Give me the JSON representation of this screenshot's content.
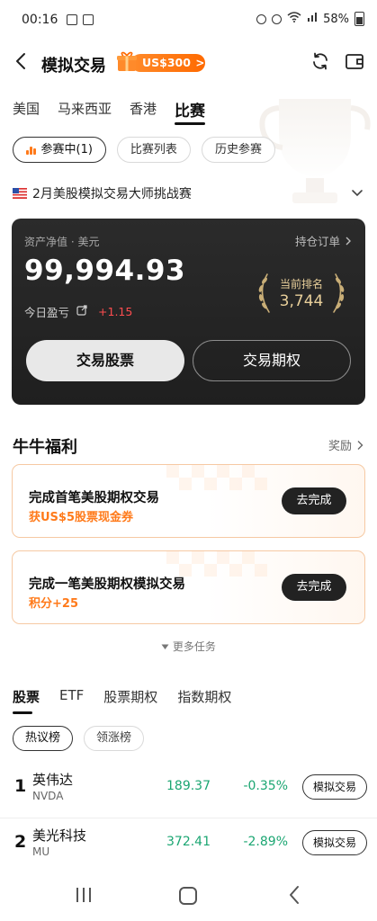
{
  "status_bar": {
    "time": "00:16",
    "battery": "58%"
  },
  "header": {
    "title": "模拟交易",
    "promo_label": "US$300",
    "promo_arrow": ">"
  },
  "market_tabs": [
    "美国",
    "马来西亚",
    "香港",
    "比赛"
  ],
  "filter_chips": [
    "参赛中(1)",
    "比赛列表",
    "历史参赛"
  ],
  "contest": {
    "name": "2月美股模拟交易大师挑战赛"
  },
  "account": {
    "label": "资产净值 · 美元",
    "orders_label": "持仓订单",
    "net_value": "99,994.93",
    "pnl_label": "今日盈亏",
    "pnl_value": "+1.15",
    "rank_label": "当前排名",
    "rank_value": "3,744",
    "trade_stock": "交易股票",
    "trade_options": "交易期权"
  },
  "welfare": {
    "title": "牛牛福利",
    "more": "奖励",
    "tasks": [
      {
        "title": "完成首笔美股期权交易",
        "reward": "获US$5股票现金券",
        "action": "去完成"
      },
      {
        "title": "完成一笔美股期权模拟交易",
        "reward": "积分+25",
        "action": "去完成"
      }
    ],
    "more_tasks": "更多任务"
  },
  "stock_tabs": [
    "股票",
    "ETF",
    "股票期权",
    "指数期权"
  ],
  "list_chips": [
    "热议榜",
    "领涨榜"
  ],
  "stocks": [
    {
      "rank": "1",
      "name": "英伟达",
      "ticker": "NVDA",
      "price": "189.37",
      "change": "-0.35%",
      "action": "模拟交易"
    },
    {
      "rank": "2",
      "name": "美光科技",
      "ticker": "MU",
      "price": "372.41",
      "change": "-2.89%",
      "action": "模拟交易"
    }
  ],
  "colors": {
    "accent": "#ff7a1a",
    "down": "#1ba672",
    "up": "#ff4d4f",
    "card_bg": "#232323",
    "rank_gold": "#e8cf9a"
  }
}
